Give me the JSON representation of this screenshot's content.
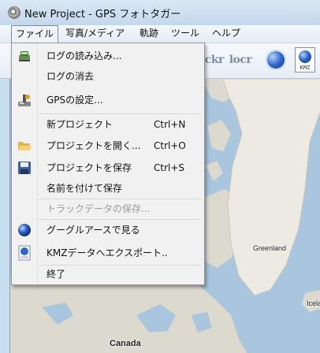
{
  "window": {
    "title": "New Project - GPS フォトタガー"
  },
  "menubar": [
    {
      "label": "ファイル",
      "active": true
    },
    {
      "label": "写真/メディア"
    },
    {
      "label": "軌跡"
    },
    {
      "label": "ツール"
    },
    {
      "label": "ヘルプ"
    }
  ],
  "toolbar": {
    "flickr_label": "lickr",
    "locr_label": "locr",
    "kmz_label": "KMZ"
  },
  "file_menu": {
    "items": [
      {
        "label": "ログの読み込み...",
        "icon": "gps-device-icon"
      },
      {
        "label": "ログの消去"
      },
      {
        "label": "GPSの設定...",
        "icon": "gps-settings-icon"
      },
      {
        "label": "新プロジェクト",
        "shortcut": "Ctrl+N"
      },
      {
        "label": "プロジェクトを開く...",
        "shortcut": "Ctrl+O",
        "icon": "open-folder-icon"
      },
      {
        "label": "プロジェクトを保存",
        "shortcut": "Ctrl+S",
        "icon": "save-disk-icon"
      },
      {
        "label": "名前を付けて保存"
      },
      {
        "label": "トラックデータの保存...",
        "disabled": true
      },
      {
        "label": "グーグルアースで見る",
        "icon": "google-earth-icon"
      },
      {
        "label": "KMZデータへエクスポート..",
        "icon": "kmz-export-icon"
      },
      {
        "label": "終了"
      }
    ]
  },
  "map": {
    "labels": [
      "Greenland",
      "Canada",
      "Icela"
    ]
  }
}
